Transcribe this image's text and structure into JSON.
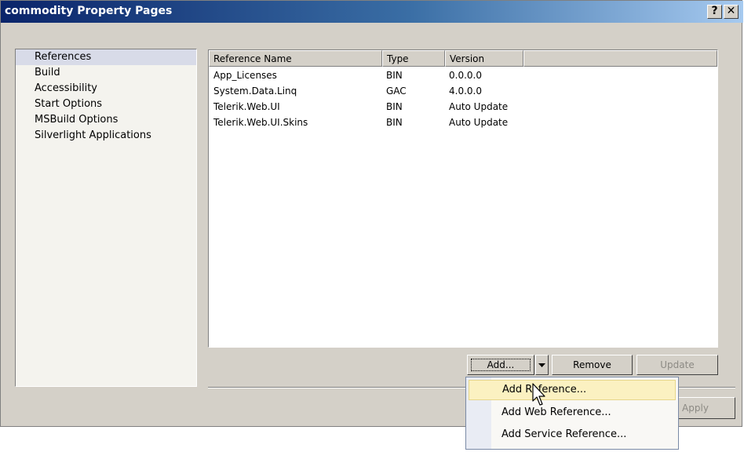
{
  "window": {
    "title": "commodity Property Pages"
  },
  "titlebar": {
    "help_label": "?",
    "close_label": "✕"
  },
  "sidebar": {
    "items": [
      {
        "label": "References",
        "selected": true
      },
      {
        "label": "Build"
      },
      {
        "label": "Accessibility"
      },
      {
        "label": "Start Options"
      },
      {
        "label": "MSBuild Options"
      },
      {
        "label": "Silverlight Applications"
      }
    ]
  },
  "references": {
    "columns": [
      "Reference Name",
      "Type",
      "Version"
    ],
    "rows": [
      {
        "name": "App_Licenses",
        "type": "BIN",
        "version": "0.0.0.0"
      },
      {
        "name": "System.Data.Linq",
        "type": "GAC",
        "version": "4.0.0.0"
      },
      {
        "name": "Telerik.Web.UI",
        "type": "BIN",
        "version": "Auto Update"
      },
      {
        "name": "Telerik.Web.UI.Skins",
        "type": "BIN",
        "version": "Auto Update"
      }
    ]
  },
  "buttons": {
    "add": "Add...",
    "remove": "Remove",
    "update": "Update",
    "apply": "Apply"
  },
  "add_menu": {
    "items": [
      {
        "label": "Add Reference...",
        "highlighted": true
      },
      {
        "label": "Add Web Reference..."
      },
      {
        "label": "Add Service Reference..."
      }
    ]
  },
  "icons": {
    "dropdown": "chevron-down-icon",
    "cursor": "mouse-pointer-icon"
  },
  "colors": {
    "titlebar_start": "#0a246a",
    "titlebar_end": "#a6caf0",
    "highlight": "#fbf1c1"
  }
}
